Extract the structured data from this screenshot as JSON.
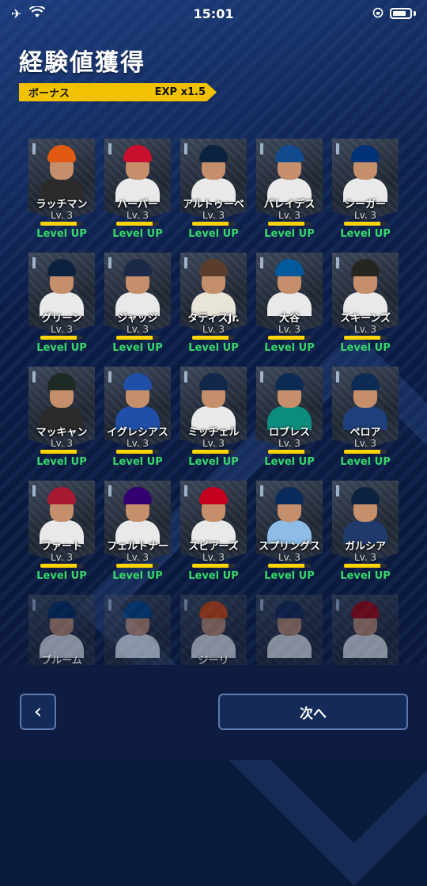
{
  "status": {
    "time": "15:01",
    "left_icons": [
      "airplane-icon",
      "wifi-icon"
    ],
    "right_icons": [
      "rotation-lock-icon",
      "battery-icon"
    ]
  },
  "title": "経験値獲得",
  "bonus": {
    "label": "ボーナス",
    "value": "EXP x1.5"
  },
  "cards": [
    {
      "name": "ラッチマン",
      "level": "Lv. 3",
      "status": "Level UP",
      "xp": 0.85,
      "jersey": "#2b2b2b",
      "helmet": "#e05a12"
    },
    {
      "name": "ハーパー",
      "level": "Lv. 3",
      "status": "Level UP",
      "xp": 0.85,
      "jersey": "#e9e9e9",
      "helmet": "#c8102e"
    },
    {
      "name": "アルトゥーベ",
      "level": "Lv. 3",
      "status": "Level UP",
      "xp": 0.85,
      "jersey": "#e9e9e9",
      "helmet": "#0c2340"
    },
    {
      "name": "パレイデス",
      "level": "Lv. 3",
      "status": "Level UP",
      "xp": 0.85,
      "jersey": "#e9e9e9",
      "helmet": "#134a8e"
    },
    {
      "name": "シーガー",
      "level": "Lv. 3",
      "status": "Level UP",
      "xp": 0.85,
      "jersey": "#e9e9e9",
      "helmet": "#003278"
    },
    {
      "name": "グリーン",
      "level": "Lv. 3",
      "status": "Level UP",
      "xp": 0.85,
      "jersey": "#e9e9e9",
      "helmet": "#0c2340"
    },
    {
      "name": "ジャッジ",
      "level": "Lv. 3",
      "status": "Level UP",
      "xp": 0.85,
      "jersey": "#e9e9e9",
      "helmet": "#1b2a46"
    },
    {
      "name": "タティスJr.",
      "level": "Lv. 3",
      "status": "Level UP",
      "xp": 0.85,
      "jersey": "#e9e4d8",
      "helmet": "#5a3e2b"
    },
    {
      "name": "大谷",
      "level": "Lv. 3",
      "status": "Level UP",
      "xp": 0.85,
      "jersey": "#e9e9e9",
      "helmet": "#005a9c"
    },
    {
      "name": "スキーンズ",
      "level": "Lv. 3",
      "status": "Level UP",
      "xp": 0.85,
      "jersey": "#e9e9e9",
      "helmet": "#27251f"
    },
    {
      "name": "マッキャン",
      "level": "Lv. 3",
      "status": "Level UP",
      "xp": 0.85,
      "jersey": "#2b2b2b",
      "helmet": "#1e2a24"
    },
    {
      "name": "イグレシアス",
      "level": "Lv. 3",
      "status": "Level UP",
      "xp": 0.85,
      "jersey": "#1f4fa8",
      "helmet": "#1f4fa8"
    },
    {
      "name": "ミッチェル",
      "level": "Lv. 3",
      "status": "Level UP",
      "xp": 0.85,
      "jersey": "#e9e9e9",
      "helmet": "#12284b"
    },
    {
      "name": "ロブレス",
      "level": "Lv. 3",
      "status": "Level UP",
      "xp": 0.85,
      "jersey": "#0c8c7c",
      "helmet": "#0c2c56"
    },
    {
      "name": "ペロア",
      "level": "Lv. 3",
      "status": "Level UP",
      "xp": 0.85,
      "jersey": "#1f3f7a",
      "helmet": "#0c2c56"
    },
    {
      "name": "ファート",
      "level": "Lv. 3",
      "status": "Level UP",
      "xp": 0.85,
      "jersey": "#e9e9e9",
      "helmet": "#a71930"
    },
    {
      "name": "フェルトナー",
      "level": "Lv. 3",
      "status": "Level UP",
      "xp": 0.85,
      "jersey": "#e9e9e9",
      "helmet": "#33006f"
    },
    {
      "name": "スピアーズ",
      "level": "Lv. 3",
      "status": "Level UP",
      "xp": 0.85,
      "jersey": "#e9e9e9",
      "helmet": "#c6011f"
    },
    {
      "name": "スプリングス",
      "level": "Lv. 3",
      "status": "Level UP",
      "xp": 0.85,
      "jersey": "#8fbce6",
      "helmet": "#092c5c"
    },
    {
      "name": "ガルシア",
      "level": "Lv. 3",
      "status": "Level UP",
      "xp": 0.85,
      "jersey": "#1f3a6b",
      "helmet": "#0c2340"
    },
    {
      "name": "ブルーム",
      "level": "",
      "status": "",
      "xp": 0,
      "jersey": "#e9e9e9",
      "helmet": "#002b5c",
      "faded": true
    },
    {
      "name": "",
      "level": "",
      "status": "",
      "xp": 0,
      "jersey": "#e9e9e9",
      "helmet": "#004687",
      "faded": true
    },
    {
      "name": "ジーリ",
      "level": "",
      "status": "",
      "xp": 0,
      "jersey": "#e9e9e9",
      "helmet": "#df4601",
      "faded": true
    },
    {
      "name": "",
      "level": "",
      "status": "",
      "xp": 0,
      "jersey": "#e9e9e9",
      "helmet": "#13274f",
      "faded": true
    },
    {
      "name": "",
      "level": "",
      "status": "",
      "xp": 0,
      "jersey": "#e9e9e9",
      "helmet": "#ab0003",
      "faded": true
    }
  ],
  "buttons": {
    "back_icon": "chevron-left-icon",
    "back_glyph": "‹",
    "next_label": "次へ"
  }
}
